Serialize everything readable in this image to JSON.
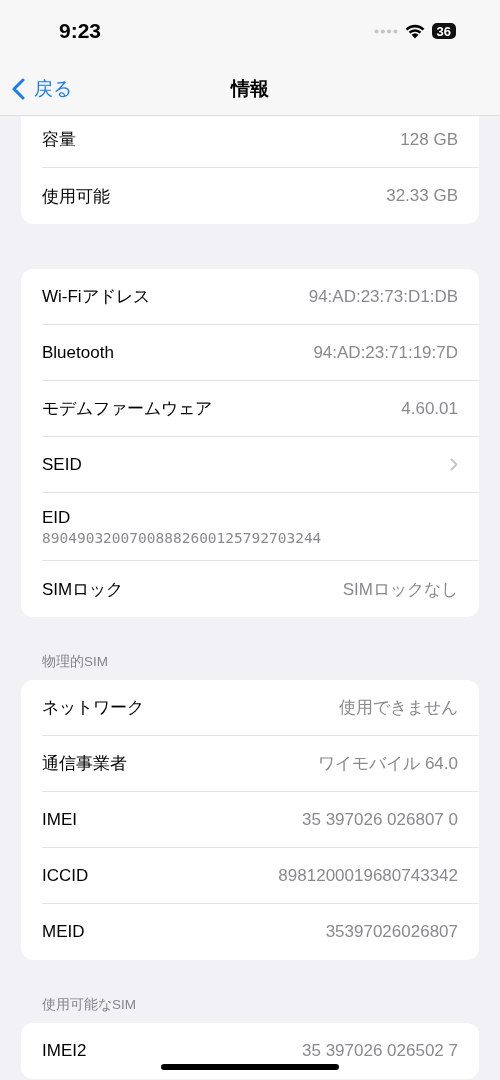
{
  "status_bar": {
    "time": "9:23",
    "battery": "36"
  },
  "nav": {
    "back": "戻る",
    "title": "情報"
  },
  "sections": [
    {
      "rows": [
        {
          "kind": "value",
          "label": "容量",
          "value": "128 GB"
        },
        {
          "kind": "value",
          "label": "使用可能",
          "value": "32.33 GB"
        }
      ]
    },
    {
      "rows": [
        {
          "kind": "value",
          "label": "Wi-Fiアドレス",
          "value": "94:AD:23:73:D1:DB"
        },
        {
          "kind": "value",
          "label": "Bluetooth",
          "value": "94:AD:23:71:19:7D"
        },
        {
          "kind": "value",
          "label": "モデムファームウェア",
          "value": "4.60.01"
        },
        {
          "kind": "chevron",
          "label": "SEID"
        },
        {
          "kind": "stacked",
          "label": "EID",
          "value": "89049032007008882600125792703244"
        },
        {
          "kind": "value",
          "label": "SIMロック",
          "value": "SIMロックなし"
        }
      ]
    },
    {
      "header": "物理的SIM",
      "rows": [
        {
          "kind": "value",
          "label": "ネットワーク",
          "value": "使用できません"
        },
        {
          "kind": "value",
          "label": "通信事業者",
          "value": "ワイモバイル 64.0"
        },
        {
          "kind": "value",
          "label": "IMEI",
          "value": "35 397026 026807 0"
        },
        {
          "kind": "value",
          "label": "ICCID",
          "value": "8981200019680743342"
        },
        {
          "kind": "value",
          "label": "MEID",
          "value": "35397026026807"
        }
      ]
    },
    {
      "header": "使用可能なSIM",
      "rows": [
        {
          "kind": "value",
          "label": "IMEI2",
          "value": "35 397026 026502 7"
        }
      ]
    }
  ]
}
